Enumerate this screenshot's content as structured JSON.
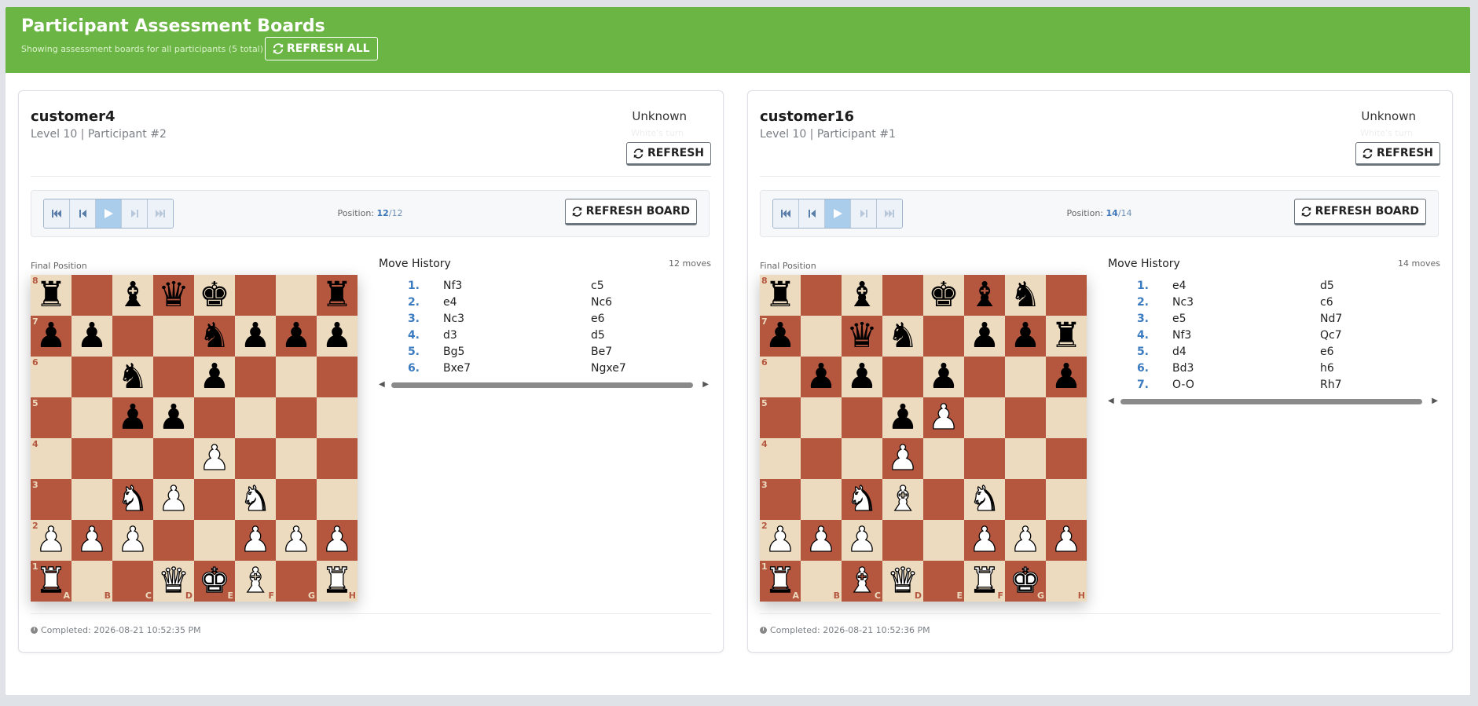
{
  "header": {
    "title": "Participant Assessment Boards",
    "subtitle": "Showing assessment boards for all participants (5 total)",
    "refresh_all_label": "REFRESH ALL",
    "accent_color": "#6bb544"
  },
  "icons": {
    "refresh": "refresh-icon",
    "first": "skip-first-icon",
    "prev": "step-back-icon",
    "play": "play-icon",
    "next": "step-forward-icon",
    "last": "skip-last-icon",
    "clock": "clock-icon"
  },
  "cards": [
    {
      "name": "customer4",
      "meta": "Level 10 | Participant #2",
      "status": "Unknown",
      "turn": "White's turn",
      "refresh_label": "REFRESH",
      "position_label": "Position: ",
      "position_current": "12",
      "position_total": "/12",
      "refresh_board_label": "REFRESH BOARD",
      "final_label": "Final Position",
      "move_history_title": "Move History",
      "move_count": "12 moves",
      "completed": "Completed: 2026-08-21 10:52:35 PM",
      "board": [
        "r.bqk..r",
        "pp..nppp",
        "..n.p...",
        "..pp....",
        "....P...",
        "..NP.N..",
        "PPP..PPP",
        "R..QKB.R"
      ],
      "moves": [
        {
          "num": "1.",
          "white": "Nf3",
          "black": "c5"
        },
        {
          "num": "2.",
          "white": "e4",
          "black": "Nc6"
        },
        {
          "num": "3.",
          "white": "Nc3",
          "black": "e6"
        },
        {
          "num": "4.",
          "white": "d3",
          "black": "d5"
        },
        {
          "num": "5.",
          "white": "Bg5",
          "black": "Be7"
        },
        {
          "num": "6.",
          "white": "Bxe7",
          "black": "Ngxe7"
        }
      ]
    },
    {
      "name": "customer16",
      "meta": "Level 10 | Participant #1",
      "status": "Unknown",
      "turn": "White's turn",
      "refresh_label": "REFRESH",
      "position_label": "Position: ",
      "position_current": "14",
      "position_total": "/14",
      "refresh_board_label": "REFRESH BOARD",
      "final_label": "Final Position",
      "move_history_title": "Move History",
      "move_count": "14 moves",
      "completed": "Completed: 2026-08-21 10:52:36 PM",
      "board": [
        "r.b.kbn.",
        "p.qn.ppr",
        ".pp.p..p",
        "...pP...",
        "...P....",
        "..NB.N..",
        "PPP..PPP",
        "R.BQ.RK."
      ],
      "moves": [
        {
          "num": "1.",
          "white": "e4",
          "black": "d5"
        },
        {
          "num": "2.",
          "white": "Nc3",
          "black": "c6"
        },
        {
          "num": "3.",
          "white": "e5",
          "black": "Nd7"
        },
        {
          "num": "4.",
          "white": "Nf3",
          "black": "Qc7"
        },
        {
          "num": "5.",
          "white": "d4",
          "black": "e6"
        },
        {
          "num": "6.",
          "white": "Bd3",
          "black": "h6"
        },
        {
          "num": "7.",
          "white": "O-O",
          "black": "Rh7"
        }
      ]
    }
  ]
}
